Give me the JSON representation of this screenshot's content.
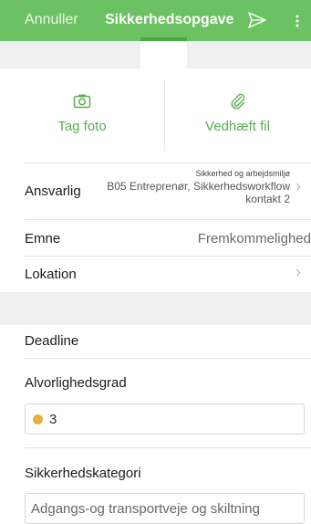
{
  "header": {
    "cancel_label": "Annuller",
    "title": "Sikkerhedsopgave",
    "accent": "#6cc262"
  },
  "actions": {
    "photo_label": "Tag foto",
    "file_label": "Vedhæft fil",
    "photo_icon": "camera-icon",
    "file_icon": "paperclip-icon"
  },
  "form": {
    "responsible": {
      "label": "Ansvarlig",
      "category": "Sikkerhed og arbejdsmiljø",
      "value": "B05 Entreprenør, Sikkerhedsworkflow kontakt 2"
    },
    "subject": {
      "label": "Emne",
      "value": "Fremkommelighed"
    },
    "location": {
      "label": "Lokation"
    },
    "deadline": {
      "label": "Deadline"
    },
    "severity": {
      "label": "Alvorlighedsgrad",
      "value": "3",
      "color": "#e7b23b"
    },
    "category": {
      "label": "Sikkerhedskategori",
      "value": "Adgangs-og transportveje og skiltning"
    }
  }
}
